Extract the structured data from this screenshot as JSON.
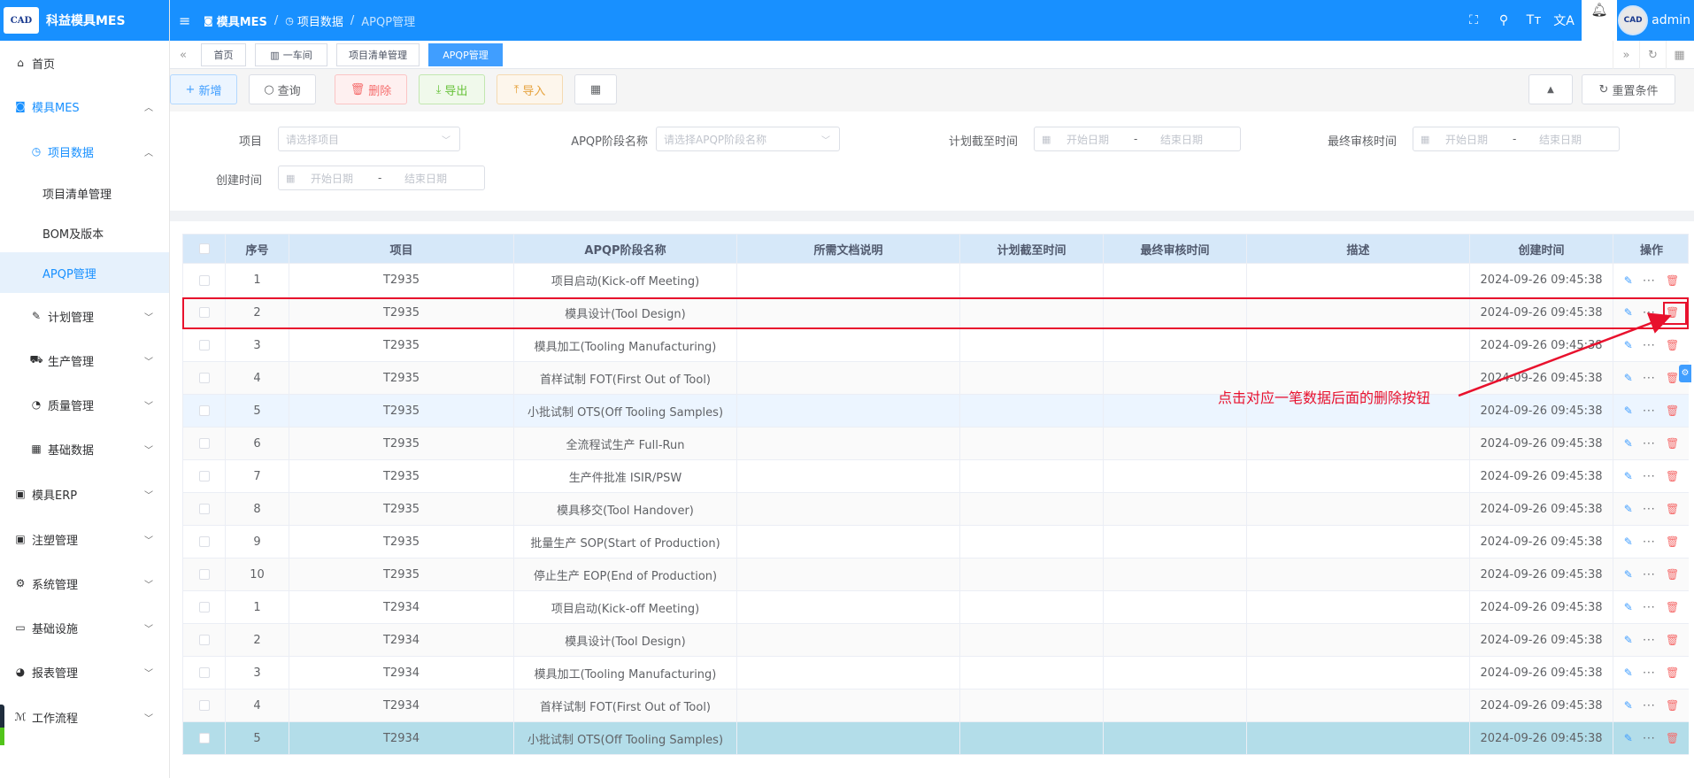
{
  "brand": {
    "logo_text": "CAD",
    "title": "科益模具MES"
  },
  "sidebar": {
    "items": [
      {
        "label": "首页",
        "icon": "home-icon"
      },
      {
        "label": "模具MES",
        "icon": "camera-icon"
      },
      {
        "label": "项目数据",
        "icon": "alarm-clock-icon"
      },
      {
        "label": "项目清单管理"
      },
      {
        "label": "BOM及版本"
      },
      {
        "label": "APQP管理"
      },
      {
        "label": "计划管理",
        "icon": "edit-icon"
      },
      {
        "label": "生产管理",
        "icon": "cart-icon"
      },
      {
        "label": "质量管理",
        "icon": "timer-icon"
      },
      {
        "label": "基础数据",
        "icon": "calendar-icon"
      },
      {
        "label": "模具ERP",
        "icon": "briefcase-icon"
      },
      {
        "label": "注塑管理",
        "icon": "briefcase-icon"
      },
      {
        "label": "系统管理",
        "icon": "gear-icon"
      },
      {
        "label": "基础设施",
        "icon": "monitor-icon"
      },
      {
        "label": "报表管理",
        "icon": "pie-icon"
      },
      {
        "label": "工作流程",
        "icon": "workflow-icon"
      }
    ]
  },
  "header": {
    "breadcrumb": [
      "模具MES",
      "项目数据",
      "APQP管理"
    ],
    "user": "admin",
    "avatar_text": "CAD"
  },
  "tags": [
    {
      "label": "首页"
    },
    {
      "label": "一车间"
    },
    {
      "label": "项目清单管理"
    },
    {
      "label": "APQP管理"
    }
  ],
  "toolbar": {
    "add": "新增",
    "query": "查询",
    "delete": "删除",
    "export": "导出",
    "import": "导入",
    "reset": "重置条件"
  },
  "filters": {
    "project_label": "项目",
    "project_placeholder": "请选择项目",
    "stage_label": "APQP阶段名称",
    "stage_placeholder": "请选择APQP阶段名称",
    "plan_label": "计划截至时间",
    "audit_label": "最终审核时间",
    "created_label": "创建时间",
    "start": "开始日期",
    "dash": "-",
    "end": "结束日期"
  },
  "table": {
    "columns": [
      "序号",
      "项目",
      "APQP阶段名称",
      "所需文档说明",
      "计划截至时间",
      "最终审核时间",
      "描述",
      "创建时间",
      "操作"
    ],
    "rows": [
      {
        "no": "1",
        "project": "T2935",
        "stage": "项目启动(Kick-off Meeting)",
        "created": "2024-09-26 09:45:38"
      },
      {
        "no": "2",
        "project": "T2935",
        "stage": "模具设计(Tool Design)",
        "created": "2024-09-26 09:45:38"
      },
      {
        "no": "3",
        "project": "T2935",
        "stage": "模具加工(Tooling Manufacturing)",
        "created": "2024-09-26 09:45:38"
      },
      {
        "no": "4",
        "project": "T2935",
        "stage": "首样试制 FOT(First Out of Tool)",
        "created": "2024-09-26 09:45:38"
      },
      {
        "no": "5",
        "project": "T2935",
        "stage": "小批试制 OTS(Off Tooling Samples)",
        "created": "2024-09-26 09:45:38"
      },
      {
        "no": "6",
        "project": "T2935",
        "stage": "全流程试生产 Full-Run",
        "created": "2024-09-26 09:45:38"
      },
      {
        "no": "7",
        "project": "T2935",
        "stage": "生产件批准 ISIR/PSW",
        "created": "2024-09-26 09:45:38"
      },
      {
        "no": "8",
        "project": "T2935",
        "stage": "模具移交(Tool Handover)",
        "created": "2024-09-26 09:45:38"
      },
      {
        "no": "9",
        "project": "T2935",
        "stage": "批量生产 SOP(Start of Production)",
        "created": "2024-09-26 09:45:38"
      },
      {
        "no": "10",
        "project": "T2935",
        "stage": "停止生产 EOP(End of Production)",
        "created": "2024-09-26 09:45:38"
      },
      {
        "no": "1",
        "project": "T2934",
        "stage": "项目启动(Kick-off Meeting)",
        "created": "2024-09-26 09:45:38"
      },
      {
        "no": "2",
        "project": "T2934",
        "stage": "模具设计(Tool Design)",
        "created": "2024-09-26 09:45:38"
      },
      {
        "no": "3",
        "project": "T2934",
        "stage": "模具加工(Tooling Manufacturing)",
        "created": "2024-09-26 09:45:38"
      },
      {
        "no": "4",
        "project": "T2934",
        "stage": "首样试制 FOT(First Out of Tool)",
        "created": "2024-09-26 09:45:38"
      },
      {
        "no": "5",
        "project": "T2934",
        "stage": "小批试制 OTS(Off Tooling Samples)",
        "created": "2024-09-26 09:45:38"
      }
    ]
  },
  "annotation": {
    "text": "点击对应一笔数据后面的删除按钮"
  },
  "colors": {
    "primary": "#1890ff",
    "annotation": "#e8112d",
    "header_row": "#d6e8f9",
    "hover_row": "#ecf5ff",
    "selected_row": "#b3dde9"
  }
}
